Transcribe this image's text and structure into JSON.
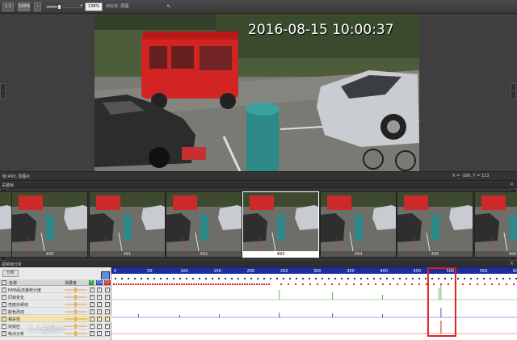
{
  "toolbar": {
    "fit_label": "1:1",
    "zoom_left": "100%",
    "zoom_value": "136%",
    "zoom_fraction": 0.36,
    "mode_label": "对比化: 原图"
  },
  "viewer": {
    "timestamp": "2016-08-15 10:00:37"
  },
  "status": {
    "left": "帧:493, 原图片",
    "right": "X = -186, Y = 113"
  },
  "strip": {
    "title": "关键帧",
    "frames": [
      {
        "label": ""
      },
      {
        "label": "490"
      },
      {
        "label": "491"
      },
      {
        "label": "492"
      },
      {
        "label": "493"
      },
      {
        "label": "494"
      },
      {
        "label": "495"
      },
      {
        "label": "496"
      }
    ],
    "selected_index": 4
  },
  "analysis": {
    "title": "视频帧分析",
    "button": "分析",
    "headers": {
      "name": "名称",
      "threshold": "测量度",
      "y": "Y",
      "cb": "Cb",
      "cr": "Cr"
    },
    "rows": [
      {
        "name": "RMS码流量统计度",
        "highlight": false
      },
      {
        "name": "同帧变化",
        "highlight": false
      },
      {
        "name": "亮度抖频动",
        "highlight": false
      },
      {
        "name": "颜色改动",
        "highlight": false
      },
      {
        "name": "相关性",
        "highlight": true
      },
      {
        "name": "块效应",
        "highlight": false
      },
      {
        "name": "噪点分析",
        "highlight": false
      }
    ],
    "watermark": "人人都是UI",
    "graph": {
      "ticks": [
        "0",
        "50",
        "100",
        "150",
        "200",
        "250",
        "300",
        "350",
        "400",
        "450",
        "500",
        "550",
        "600"
      ],
      "marker_frame": 493,
      "highlight_color": "#e02020"
    }
  }
}
